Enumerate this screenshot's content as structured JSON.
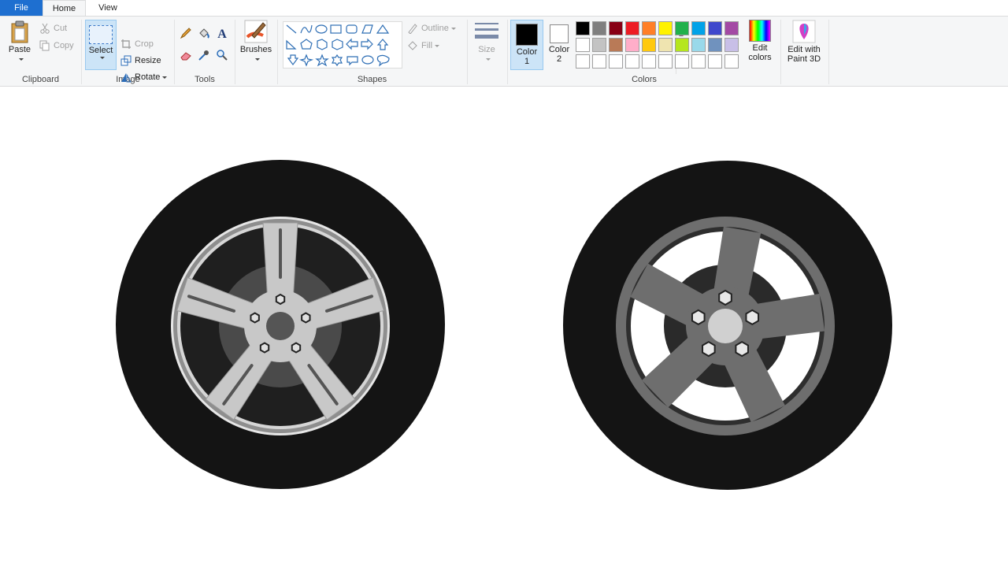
{
  "tabs": {
    "file": "File",
    "home": "Home",
    "view": "View"
  },
  "clipboard": {
    "paste": "Paste",
    "cut": "Cut",
    "copy": "Copy",
    "label": "Clipboard"
  },
  "image": {
    "select": "Select",
    "crop": "Crop",
    "resize": "Resize",
    "rotate": "Rotate",
    "label": "Image"
  },
  "tools": {
    "label": "Tools",
    "text_glyph": "A"
  },
  "brushes": {
    "label": "Brushes"
  },
  "shapes": {
    "outline": "Outline",
    "fill": "Fill",
    "label": "Shapes"
  },
  "size": {
    "label": "Size"
  },
  "colors": {
    "color1_label": "Color",
    "color1_num": "1",
    "color2_label": "Color",
    "color2_num": "2",
    "color1": "#000000",
    "color2": "#ffffff",
    "edit_label": "Edit",
    "edit_label2": "colors",
    "label": "Colors",
    "palette_row1": [
      "#000000",
      "#7f7f7f",
      "#880015",
      "#ed1c24",
      "#ff7f27",
      "#fff200",
      "#22b14c",
      "#00a2e8",
      "#3f48cc",
      "#a349a4"
    ],
    "palette_row2": [
      "#ffffff",
      "#c3c3c3",
      "#b97a57",
      "#ffaec9",
      "#ffc90e",
      "#efe4b0",
      "#b5e61d",
      "#99d9ea",
      "#7092be",
      "#c8bfe7"
    ],
    "palette_row3": [
      "#ffffff",
      "#ffffff",
      "#ffffff",
      "#ffffff",
      "#ffffff",
      "#ffffff",
      "#ffffff",
      "#ffffff",
      "#ffffff",
      "#ffffff"
    ]
  },
  "paint3d": {
    "line1": "Edit with",
    "line2": "Paint 3D"
  },
  "drawing": {
    "tire": "#141414",
    "rim_light": "#c8c8c8",
    "rim_dark": "#6e6e6e",
    "hub_dark": "#2a2a2a"
  }
}
